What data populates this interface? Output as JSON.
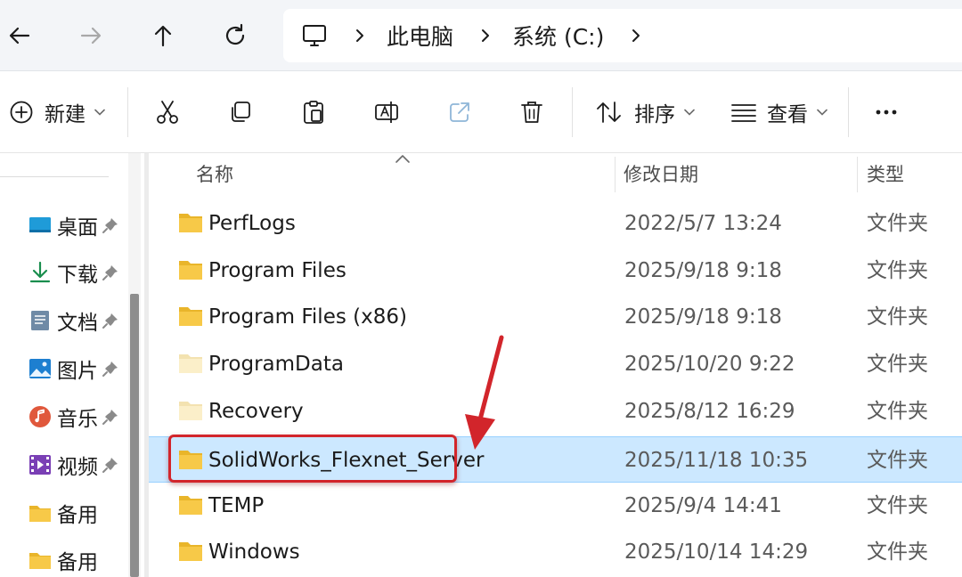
{
  "address_bar": {
    "crumbs": [
      "此电脑",
      "系统 (C:)"
    ]
  },
  "toolbar": {
    "new_label": "新建",
    "sort_label": "排序",
    "view_label": "查看"
  },
  "sidebar": {
    "items": [
      {
        "label": "桌面",
        "icon": "desktop-icon",
        "pinned": true
      },
      {
        "label": "下载",
        "icon": "download-icon",
        "pinned": true
      },
      {
        "label": "文档",
        "icon": "document-icon",
        "pinned": true
      },
      {
        "label": "图片",
        "icon": "picture-icon",
        "pinned": true
      },
      {
        "label": "音乐",
        "icon": "music-icon",
        "pinned": true
      },
      {
        "label": "视频",
        "icon": "video-icon",
        "pinned": true
      },
      {
        "label": "备用",
        "icon": "folder-icon",
        "pinned": false
      },
      {
        "label": "备用",
        "icon": "folder-icon",
        "pinned": false
      }
    ]
  },
  "columns": {
    "name": "名称",
    "date": "修改日期",
    "type": "类型"
  },
  "files": [
    {
      "name": "PerfLogs",
      "date": "2022/5/7 13:24",
      "type": "文件夹",
      "hidden": false
    },
    {
      "name": "Program Files",
      "date": "2025/9/18 9:18",
      "type": "文件夹",
      "hidden": false
    },
    {
      "name": "Program Files (x86)",
      "date": "2025/9/18 9:18",
      "type": "文件夹",
      "hidden": false
    },
    {
      "name": "ProgramData",
      "date": "2025/10/20 9:22",
      "type": "文件夹",
      "hidden": true
    },
    {
      "name": "Recovery",
      "date": "2025/8/12 16:29",
      "type": "文件夹",
      "hidden": true
    },
    {
      "name": "SolidWorks_Flexnet_Server",
      "date": "2025/11/18 10:35",
      "type": "文件夹",
      "hidden": false,
      "selected": true
    },
    {
      "name": "TEMP",
      "date": "2025/9/4 14:41",
      "type": "文件夹",
      "hidden": false
    },
    {
      "name": "Windows",
      "date": "2025/10/14 14:29",
      "type": "文件夹",
      "hidden": false
    }
  ],
  "colors": {
    "selection": "#cce8ff",
    "annotation": "#d2252b",
    "folder": "#f7c948"
  }
}
